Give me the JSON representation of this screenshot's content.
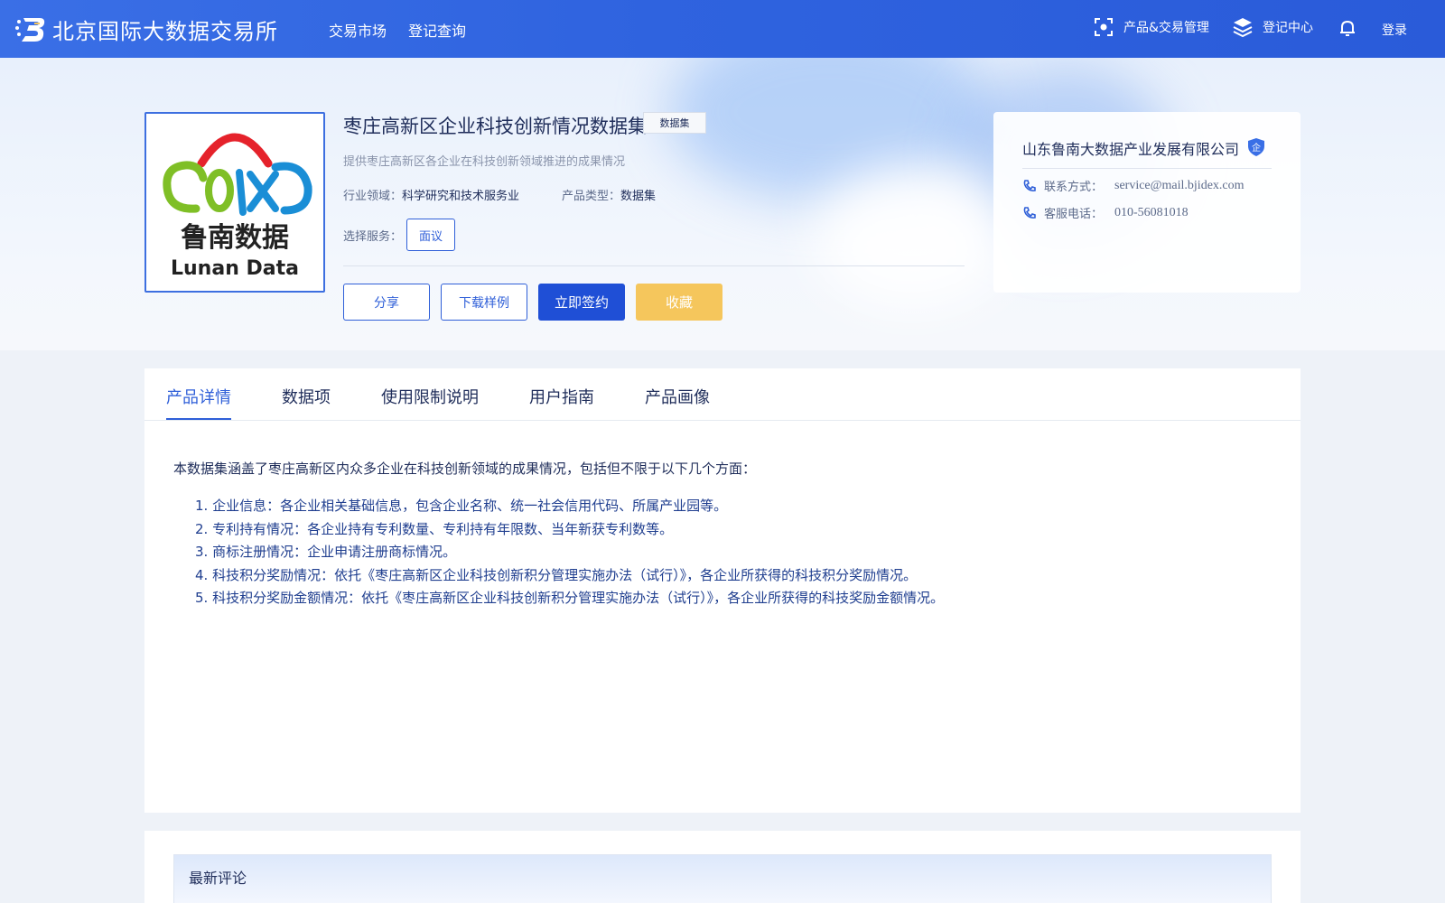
{
  "header": {
    "brand_name": "北京国际大数据交易所",
    "nav": [
      "交易市场",
      "登记查询"
    ],
    "right": {
      "product_mgmt": "产品&交易管理",
      "register_center": "登记中心",
      "login": "登录"
    }
  },
  "product": {
    "title": "枣庄高新区企业科技创新情况数据集",
    "tag": "数据集",
    "subtitle": "提供枣庄高新区各企业在科技创新领域推进的成果情况",
    "industry_label": "行业领域：",
    "industry_value": "科学研究和技术服务业",
    "type_label": "产品类型：",
    "type_value": "数据集",
    "select_service_label": "选择服务：",
    "service_option": "面议",
    "logo_text_cn": "鲁南数据",
    "logo_text_en": "Lunan Data",
    "buttons": {
      "share": "分享",
      "download_sample": "下载样例",
      "sign_now": "立即签约",
      "favorite": "收藏"
    }
  },
  "company": {
    "name": "山东鲁南大数据产业发展有限公司",
    "verified_badge": "企",
    "contact_label": "联系方式：",
    "contact_value": "service@mail.bjidex.com",
    "phone_label": "客服电话：",
    "phone_value": "010-56081018"
  },
  "tabs": [
    "产品详情",
    "数据项",
    "使用限制说明",
    "用户指南",
    "产品画像"
  ],
  "detail": {
    "intro": "本数据集涵盖了枣庄高新区内众多企业在科技创新领域的成果情况，包括但不限于以下几个方面：",
    "items": [
      {
        "num": "1.",
        "text": "企业信息：各企业相关基础信息，包含企业名称、统一社会信用代码、所属产业园等。"
      },
      {
        "num": "2.",
        "text": "专利持有情况：各企业持有专利数量、专利持有年限数、当年新获专利数等。"
      },
      {
        "num": "3.",
        "text": "商标注册情况：企业申请注册商标情况。"
      },
      {
        "num": "4.",
        "text": "科技积分奖励情况：依托《枣庄高新区企业科技创新积分管理实施办法（试行）》，各企业所获得的科技积分奖励情况。"
      },
      {
        "num": "5.",
        "text": "科技积分奖励金额情况：依托《枣庄高新区企业科技创新积分管理实施办法（试行）》，各企业所获得的科技奖励金额情况。"
      }
    ]
  },
  "comments": {
    "title": "最新评论"
  },
  "colors": {
    "primary": "#1f4fd6",
    "accent_blue": "#2f5fd8",
    "favorite_yellow": "#f5c65c",
    "header_blue": "#2f63df"
  }
}
